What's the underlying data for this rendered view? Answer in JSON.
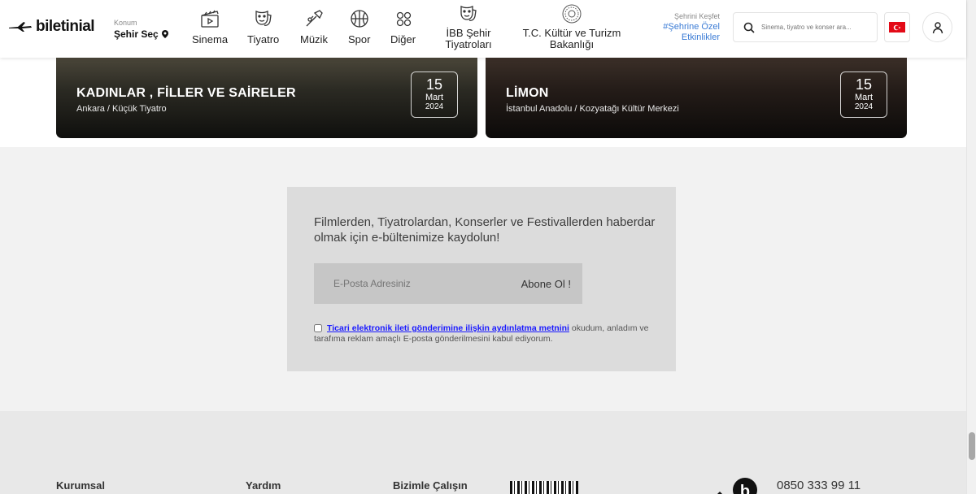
{
  "header": {
    "logo_text": "biletinial",
    "location_label": "Konum",
    "location_value": "Şehir Seç",
    "nav": [
      {
        "label": "Sinema",
        "icon": "clapperboard-icon"
      },
      {
        "label": "Tiyatro",
        "icon": "theater-masks-icon"
      },
      {
        "label": "Müzik",
        "icon": "trumpet-icon"
      },
      {
        "label": "Spor",
        "icon": "basketball-icon"
      },
      {
        "label": "Diğer",
        "icon": "grid-circles-icon"
      },
      {
        "label": "İBB Şehir Tiyatroları",
        "icon": "theater-masks-icon"
      },
      {
        "label": "T.C. Kültür ve Turizm Bakanlığı",
        "icon": "ministry-seal-icon"
      }
    ],
    "discover_label": "Şehrini Keşfet",
    "discover_link": "#Şehrine Özel Etkinlikler",
    "search_placeholder": "Sinema, tiyatro ve konser ara...",
    "accent_color": "#3a7bd5"
  },
  "events": [
    {
      "title": "KADINLAR , FİLLER VE SAİRELER",
      "venue": "Ankara / Küçük Tiyatro",
      "day": "15",
      "month": "Mart",
      "year": "2024"
    },
    {
      "title": "LİMON",
      "venue": "İstanbul Anadolu / Kozyatağı Kültür Merkezi",
      "day": "15",
      "month": "Mart",
      "year": "2024"
    }
  ],
  "newsletter": {
    "title": "Filmlerden, Tiyatrolardan, Konserler ve Festivallerden haberdar olmak için e-bültenimize kaydolun!",
    "email_placeholder": "E-Posta Adresiniz",
    "subscribe_label": "Abone Ol !",
    "consent_link": "Ticari elektronik ileti gönderimine ilişkin aydınlatma metnini",
    "consent_text": " okudum, anladım ve tarafıma reklam amaçlı E-posta gönderilmesini kabul ediyorum."
  },
  "footer": {
    "col1": "Kurumsal",
    "col2": "Yardım",
    "col3": "Bizimle Çalışın",
    "phone": "0850 333 99 11"
  }
}
